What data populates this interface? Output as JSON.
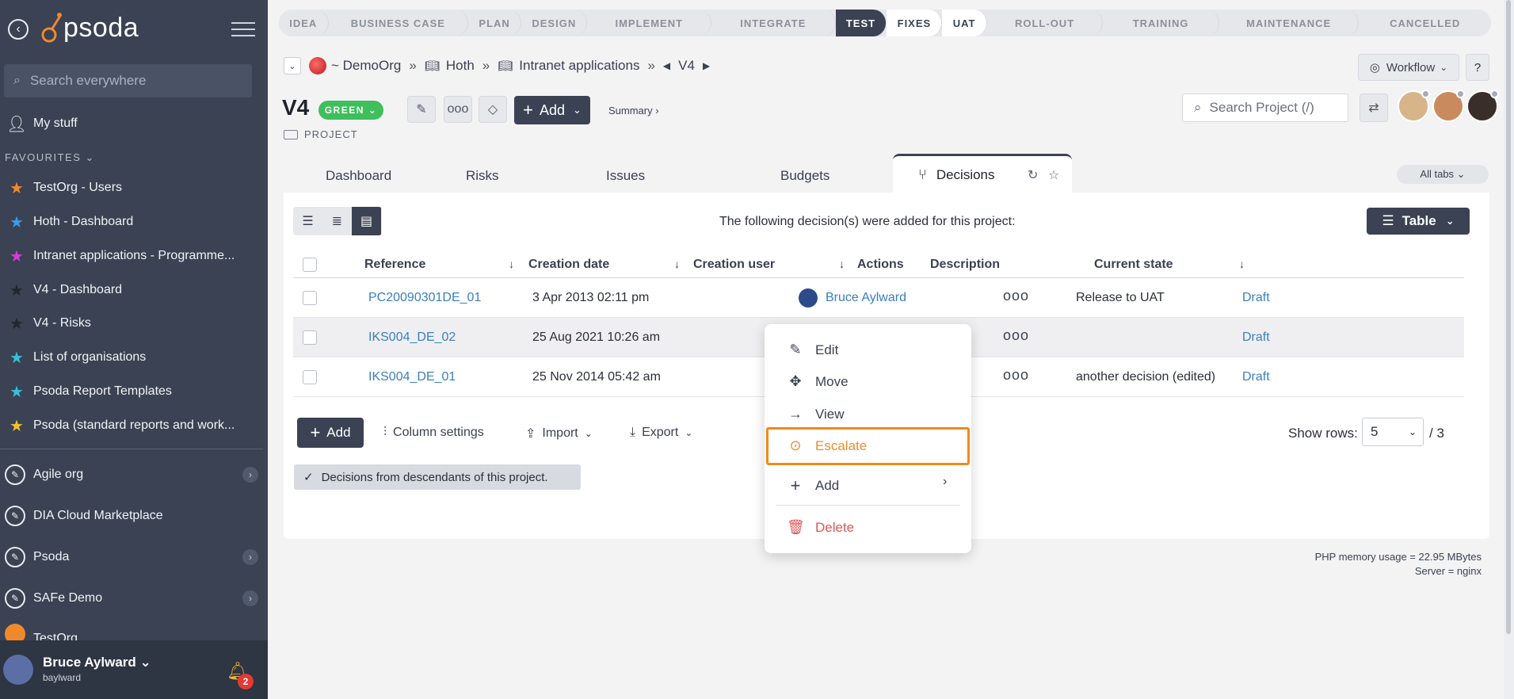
{
  "sidebar": {
    "logo_text": "psoda",
    "search_placeholder": "Search everywhere",
    "my_stuff": "My stuff",
    "favourites_header": "FAVOURITES ⌄",
    "favourites": [
      {
        "label": "TestOrg - Users",
        "star_color": "#f0892c"
      },
      {
        "label": "Hoth - Dashboard",
        "star_color": "#3d9be9"
      },
      {
        "label": "Intranet applications - Programme...",
        "star_color": "#d63cd6"
      },
      {
        "label": "V4 - Dashboard",
        "star_color": "#2b2f38"
      },
      {
        "label": "V4 - Risks",
        "star_color": "#2b2f38"
      },
      {
        "label": "List of organisations",
        "star_color": "#35c1d6"
      },
      {
        "label": "Psoda Report Templates",
        "star_color": "#35c1d6"
      },
      {
        "label": "Psoda (standard reports and work...",
        "star_color": "#f0c02c"
      }
    ],
    "orgs": [
      {
        "label": "Agile org",
        "has_children": true
      },
      {
        "label": "DIA Cloud Marketplace",
        "has_children": false
      },
      {
        "label": "Psoda",
        "has_children": true
      },
      {
        "label": "SAFe Demo",
        "has_children": true
      },
      {
        "label": "TestOrg",
        "has_children": true
      }
    ],
    "user": {
      "name": "Bruce Aylward",
      "username": "baylward",
      "notifications": "2"
    }
  },
  "stages": [
    {
      "label": "IDEA",
      "state": "done"
    },
    {
      "label": "BUSINESS CASE",
      "state": "done"
    },
    {
      "label": "PLAN",
      "state": "done"
    },
    {
      "label": "DESIGN",
      "state": "done"
    },
    {
      "label": "IMPLEMENT",
      "state": "done"
    },
    {
      "label": "INTEGRATE",
      "state": "done"
    },
    {
      "label": "TEST",
      "state": "active"
    },
    {
      "label": "FIXES",
      "state": "next"
    },
    {
      "label": "UAT",
      "state": "next"
    },
    {
      "label": "ROLL-OUT",
      "state": "future"
    },
    {
      "label": "TRAINING",
      "state": "future"
    },
    {
      "label": "MAINTENANCE",
      "state": "future"
    },
    {
      "label": "CANCELLED",
      "state": "future"
    }
  ],
  "breadcrumb": {
    "org": "~ DemoOrg",
    "program": "Hoth",
    "project_group": "Intranet applications",
    "current": "V4"
  },
  "header": {
    "title": "V4",
    "status": "GREEN",
    "add_label": "Add",
    "summary_label": "Summary ›",
    "type_label": "PROJECT",
    "workflow_label": "Workflow",
    "help_label": "?",
    "search_placeholder": "Search Project (/)"
  },
  "tabs": {
    "items": [
      "Dashboard",
      "Risks",
      "Issues",
      "Budgets"
    ],
    "active": "Decisions",
    "all_tabs": "All tabs ⌄"
  },
  "panel": {
    "caption": "The following decision(s) were added for this project:",
    "view_label": "Table",
    "columns": [
      "Reference",
      "Creation date",
      "Creation user",
      "Actions",
      "Description",
      "Current state"
    ],
    "rows": [
      {
        "reference": "PC20090301DE_01",
        "date": "3 Apr 2013 02:11 pm",
        "user": "Bruce Aylward",
        "actions": "ooo",
        "description": "Release to UAT",
        "state": "Draft"
      },
      {
        "reference": "IKS004_DE_02",
        "date": "25 Aug 2021 10:26 am",
        "user": "",
        "actions": "ooo",
        "description": "",
        "state": "Draft"
      },
      {
        "reference": "IKS004_DE_01",
        "date": "25 Nov 2014 05:42 am",
        "user": "",
        "actions": "ooo",
        "description": "another decision (edited)",
        "state": "Draft"
      }
    ],
    "add_label": "Add",
    "column_settings": "Column settings",
    "import_label": "Import",
    "export_label": "Export",
    "show_rows_label": "Show rows:",
    "rows_value": "5",
    "rows_total": "/ 3",
    "descendants_chip": "Decisions from descendants of this project."
  },
  "context_menu": {
    "items": [
      {
        "label": "Edit",
        "icon": "pencil-icon"
      },
      {
        "label": "Move",
        "icon": "move-icon"
      },
      {
        "label": "View",
        "icon": "arrow-right-icon"
      },
      {
        "label": "Escalate",
        "icon": "escalate-icon"
      },
      {
        "label": "Add",
        "icon": "plus-icon"
      },
      {
        "label": "Delete",
        "icon": "trash-icon"
      }
    ],
    "highlight_color": "#f08a1a"
  },
  "footer": {
    "memory": "PHP memory usage = 22.95 MBytes",
    "server": "Server = nginx"
  },
  "colors": {
    "sidebar_bg": "#3a4253",
    "accent_dark": "#3a4253",
    "link": "#3a7fc0",
    "status_green": "#3fbf5b"
  }
}
